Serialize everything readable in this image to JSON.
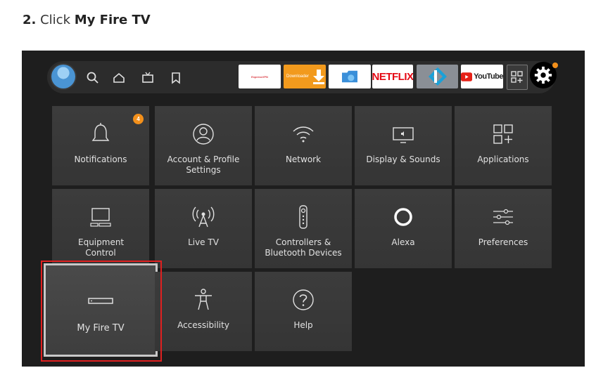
{
  "instruction": {
    "step_number": "2.",
    "verb": "Click",
    "target": "My Fire TV"
  },
  "nav": {
    "icons": [
      "profile-avatar",
      "search-icon",
      "home-icon",
      "live-tv-icon",
      "bookmark-icon"
    ]
  },
  "apps": {
    "expressvpn_label": "ExpressVPN",
    "downloader_label": "Downloader",
    "netflix_label": "NETFLIX",
    "youtube_label": "YouTube"
  },
  "tiles": {
    "notifications": {
      "label": "Notifications",
      "badge": "4"
    },
    "account": {
      "label": "Account & Profile Settings"
    },
    "network": {
      "label": "Network"
    },
    "display": {
      "label": "Display & Sounds"
    },
    "applications": {
      "label": "Applications"
    },
    "equipment": {
      "label": "Equipment Control"
    },
    "livetv": {
      "label": "Live TV"
    },
    "controllers": {
      "label": "Controllers & Bluetooth Devices"
    },
    "alexa": {
      "label": "Alexa"
    },
    "preferences": {
      "label": "Preferences"
    },
    "myfiretv": {
      "label": "My Fire TV"
    },
    "accessibility": {
      "label": "Accessibility"
    },
    "help": {
      "label": "Help"
    }
  },
  "colors": {
    "highlight": "#e02020",
    "badge": "#f3901b",
    "background": "#1e1e1e"
  }
}
